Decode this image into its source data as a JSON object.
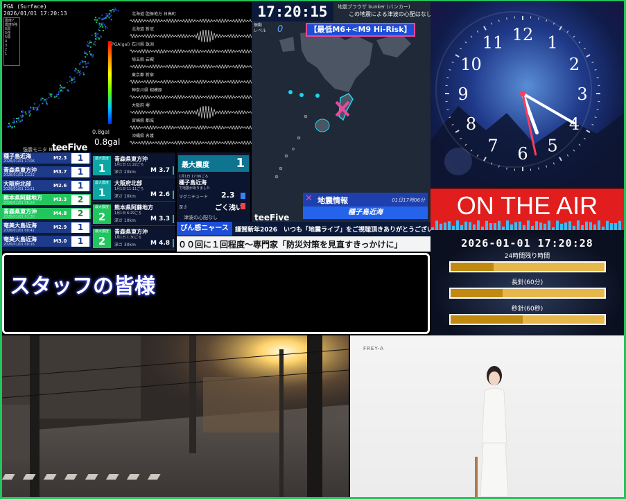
{
  "seismic": {
    "header_lines": [
      "PGA (Surface)",
      "2026/01/01 17:20:13"
    ],
    "legend_lines": [
      "震度7",
      "震度6強",
      "6弱",
      "5強",
      "5弱",
      "4",
      "3",
      "2",
      "1"
    ],
    "pga_label": "PGA(gal)",
    "pga_min": "0.8gal",
    "pga_value": "0.8gal",
    "brand": "teeFive",
    "brand_small": "強震モニタ NEW",
    "stations": [
      {
        "name": "北海道 胆振地方 日高町"
      },
      {
        "name": "北海道 新冠"
      },
      {
        "name": "石川県 珠洲"
      },
      {
        "name": "埼玉県 岩槻"
      },
      {
        "name": "東京都 新宿"
      },
      {
        "name": "神奈川県 相模原"
      },
      {
        "name": "大阪府 堺"
      },
      {
        "name": "宮崎県 都城"
      },
      {
        "name": "沖縄県 名護"
      }
    ]
  },
  "eq_list": {
    "caption": "地震速報",
    "rows": [
      {
        "place": "種子島近海",
        "date": "2026/01/01 17:06",
        "mag": "M2.3",
        "int": "1",
        "selected": false
      },
      {
        "place": "青森県東方沖",
        "date": "2026/01/01 11:22",
        "mag": "M3.7",
        "int": "1",
        "selected": false
      },
      {
        "place": "大阪府北部",
        "date": "2026/01/01 11:11",
        "mag": "M2.6",
        "int": "1",
        "selected": false
      },
      {
        "place": "熊本県阿蘇地方",
        "date": "2026/01/01 06:29",
        "mag": "M3.3",
        "int": "2",
        "selected": true
      },
      {
        "place": "青森県東方沖",
        "date": "2026/01/01 01:30",
        "mag": "M4.8",
        "int": "2",
        "selected": true
      },
      {
        "place": "奄美大島近海",
        "date": "2026/01/01 00:42",
        "mag": "M2.9",
        "int": "1",
        "selected": false
      },
      {
        "place": "奄美大島近海",
        "date": "2026/01/01 00:16",
        "mag": "M3.0",
        "int": "1",
        "selected": false
      }
    ]
  },
  "cards": [
    {
      "small": "最大震度",
      "int": "1",
      "place": "青森県東方沖",
      "time": "1月1日 11:22ごろ",
      "depth": "深さ 20km",
      "mag": "M 3.7",
      "green": false
    },
    {
      "small": "最大震度",
      "int": "1",
      "place": "大阪府北部",
      "time": "1月1日 11:11ごろ",
      "depth": "深さ 10km",
      "mag": "M 2.6",
      "green": false
    },
    {
      "small": "最大震度",
      "int": "2",
      "place": "熊本県阿蘇地方",
      "time": "1月1日 6:29ごろ",
      "depth": "深さ 10km",
      "mag": "M 3.3",
      "green": true
    },
    {
      "small": "最大震度",
      "int": "2",
      "place": "青森県東方沖",
      "time": "1月1日 1:30ごろ",
      "depth": "深さ 30km",
      "mag": "M 4.8",
      "green": true
    }
  ],
  "max_intensity": {
    "title": "最大震度",
    "value": "1",
    "time": "1月1日 17:06ごろ",
    "place": "種子島近海",
    "sub": "で地震がありました",
    "mag_label": "マグニチュード",
    "mag_value": "2.3",
    "depth_label": "深さ",
    "depth_value": "ごく浅い",
    "tsunami": "津波の心配なし"
  },
  "map": {
    "clock": "17:20:15",
    "feed_title": "地震ブラウザ bunker (バンカー)",
    "feed_sub": "この地震による津波の心配はなし",
    "shindo_label_1": "振動",
    "shindo_label_2": "レベル",
    "shindo_value": "0",
    "risk": "【最低M6+<M9 Hi-Risk】",
    "brand": "teeFive",
    "info_x": "✕",
    "info_title": "地震情報",
    "info_date": "01日17時06分",
    "info_place": "種子島近海"
  },
  "ticker": {
    "tag": "ぴん感ニャース",
    "line1": "謹賀新年2026　いつも「地震ライブ」をご視聴頂きありがとうございます!",
    "line2": "００回に１回程度〜専門家「防災対策を見直すきっかけに」"
  },
  "staff": {
    "text": "スタッフの皆様"
  },
  "clock_panel": {
    "numbers": [
      "12",
      "1",
      "2",
      "3",
      "4",
      "5",
      "6",
      "7",
      "8",
      "9",
      "10",
      "11"
    ],
    "hour": 5,
    "minute": 20,
    "second": 28
  },
  "on_air": {
    "text": "ON THE AIR"
  },
  "countdown": {
    "datetime": "2026-01-01 17:20:28",
    "bars": [
      {
        "label": "24時間残り時間",
        "fill": 0.28
      },
      {
        "label": "長針(60分)",
        "fill": 0.34
      },
      {
        "label": "秒針(60秒)",
        "fill": 0.47
      }
    ]
  },
  "studio": {
    "logo": "FREY-A"
  },
  "colors": {
    "frame": "#22c55e",
    "on_air_red": "#e11d1d",
    "eq_blue": "#1e3a8a",
    "eq_green": "#22c55e",
    "risk_border": "#ec4899"
  }
}
